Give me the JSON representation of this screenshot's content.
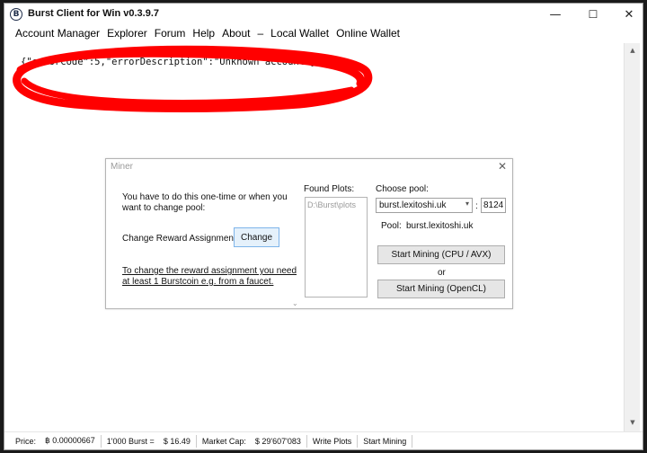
{
  "window": {
    "title": "Burst Client for Win v0.3.9.7",
    "icon": "burst-logo-icon",
    "controls": {
      "minimize": "—",
      "maximize": "☐",
      "close": "✕"
    }
  },
  "menu": {
    "items": [
      "Account Manager",
      "Explorer",
      "Forum",
      "Help",
      "About",
      "–",
      "Local Wallet",
      "Online Wallet"
    ]
  },
  "content": {
    "response_text": "{\"errorCode\":5,\"errorDescription\":\"Unknown account\"}",
    "annotation_color": "#ff0000"
  },
  "miner": {
    "title": "Miner",
    "close": "✕",
    "instruction_line1": "You have to do this one-time or when you",
    "instruction_line2": "want to change pool:",
    "change_reward_label": "Change Reward Assignment:",
    "change_button": "Change",
    "link_line1": "To change the reward assignment you need",
    "link_line2": "at least 1 Burstcoin e.g. from a faucet.",
    "found_plots_label": "Found Plots:",
    "found_plots_items": [
      "D:\\Burst\\plots"
    ],
    "choose_pool_label": "Choose pool:",
    "pool_selected": "burst.lexitoshi.uk",
    "port_separator": ":",
    "port": "8124",
    "pool_label": "Pool:",
    "pool_value": "burst.lexitoshi.uk",
    "start_cpu_button": "Start Mining (CPU / AVX)",
    "or_text": "or",
    "start_opencl_button": "Start Mining (OpenCL)",
    "grip": "⌄"
  },
  "statusbar": {
    "price_label": "Price:",
    "price_value": "฿ 0.00000667",
    "burst_label": "1'000 Burst =",
    "burst_value": "$ 16.49",
    "marketcap_label": "Market Cap:",
    "marketcap_value": "$ 29'607'083",
    "write_plots": "Write Plots",
    "start_mining": "Start Mining"
  }
}
